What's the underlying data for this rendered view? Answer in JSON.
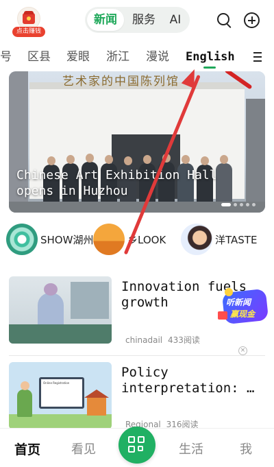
{
  "header": {
    "earn_label": "点击赚钱",
    "tabs": [
      {
        "label": "新闻",
        "active": true
      },
      {
        "label": "服务",
        "active": false
      },
      {
        "label": "AI",
        "active": false
      }
    ],
    "accent_color": "#1fa85a"
  },
  "channels": {
    "items": [
      "号",
      "区县",
      "爱眼",
      "浙江",
      "漫说",
      "English"
    ],
    "active": "English"
  },
  "banner": {
    "caption": "Chinese Art Exhibition Hall opens in Huzhou",
    "calligraphy": "艺术家的中国陈列馆"
  },
  "shortcuts": [
    {
      "label": "SHOW湖州"
    },
    {
      "label": "乡LOOK"
    },
    {
      "label": "洋TASTE"
    }
  ],
  "news": [
    {
      "title": "Innovation fuels growth",
      "source": "chinadail",
      "reads": "433阅读"
    },
    {
      "title": "Policy interpretation: …",
      "source": "Regional",
      "reads": "316阅读"
    }
  ],
  "promo": {
    "line1": "听新闻",
    "line2": "赢现金"
  },
  "bottom_nav": [
    {
      "label": "首页",
      "active": true
    },
    {
      "label": "看见",
      "active": false
    },
    {
      "label": "生活",
      "active": false
    },
    {
      "label": "我",
      "active": false
    }
  ]
}
